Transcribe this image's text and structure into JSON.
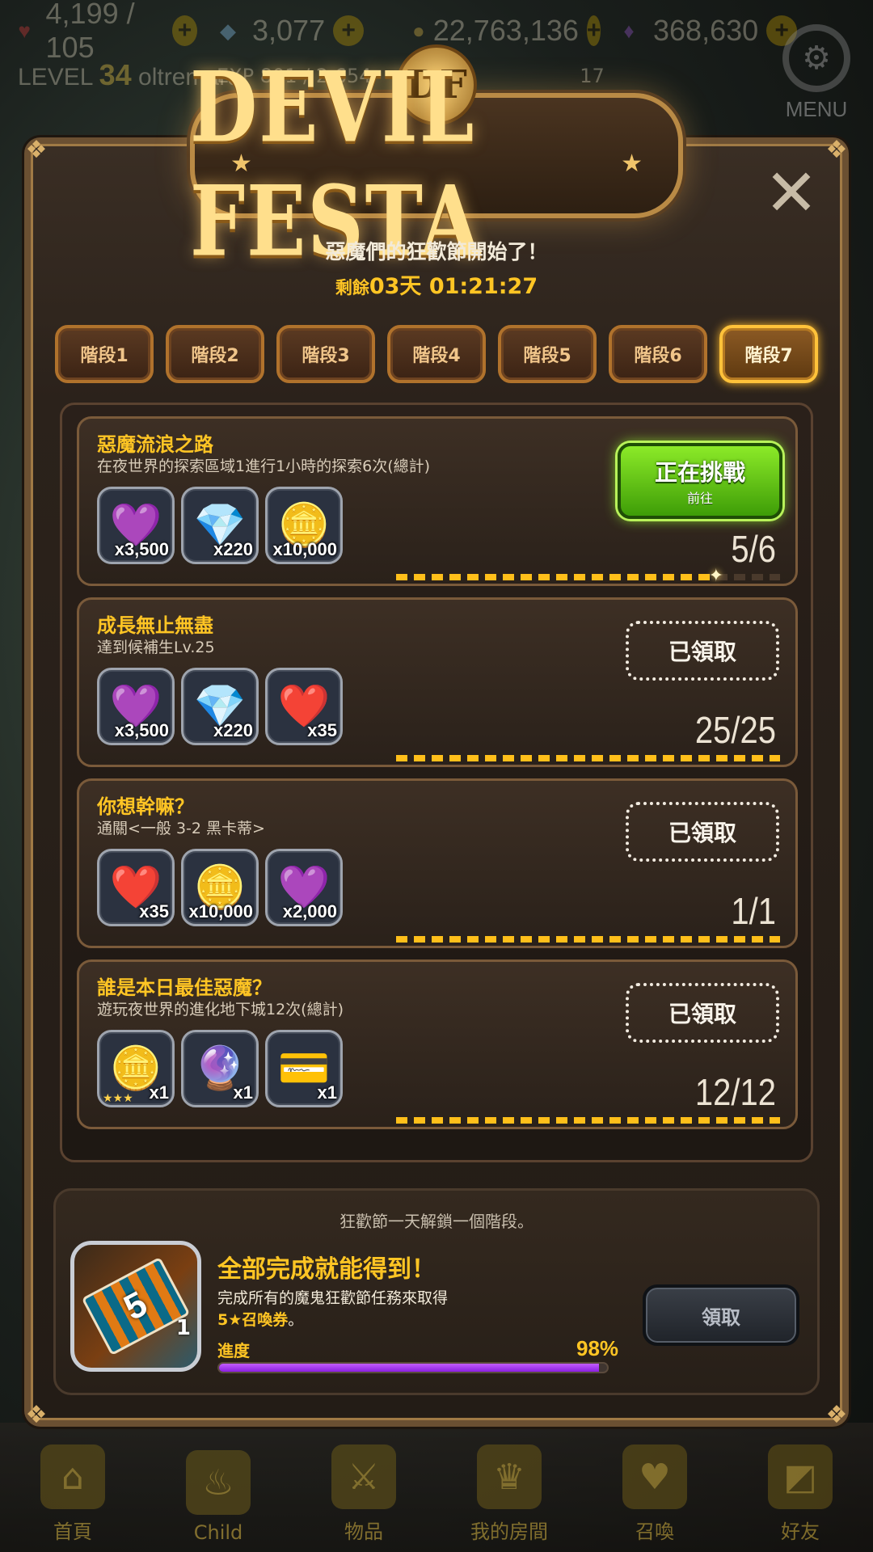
{
  "hud": {
    "stamina": "4,199 / 105",
    "crystals": "3,077",
    "gold": "22,763,136",
    "gems": "368,630",
    "level_label": "LEVEL",
    "level_value": "34",
    "player_name": "oltremare",
    "exp": "EXP 801 / 2,654",
    "tickets": "17",
    "menu_label": "MENU"
  },
  "dialog": {
    "title": "DEVIL FESTA",
    "crest": "DF",
    "subtitle": "惡魔們的狂歡節開始了！",
    "countdown_label": "剩餘",
    "countdown_value": "03天 01:21:27",
    "close": "✕"
  },
  "stage_tabs": [
    {
      "label": "階段1",
      "active": false
    },
    {
      "label": "階段2",
      "active": false
    },
    {
      "label": "階段3",
      "active": false
    },
    {
      "label": "階段4",
      "active": false
    },
    {
      "label": "階段5",
      "active": false
    },
    {
      "label": "階段6",
      "active": false
    },
    {
      "label": "階段7",
      "active": true
    }
  ],
  "missions": [
    {
      "title": "惡魔流浪之路",
      "desc": "在夜世界的探索區域1進行1小時的探索6次(總計)",
      "rewards": [
        {
          "icon": "purple-gem-icon",
          "glyph": "💜",
          "qty": "x3,500"
        },
        {
          "icon": "rainbow-crystal-icon",
          "glyph": "💎",
          "qty": "x220"
        },
        {
          "icon": "gold-coins-icon",
          "glyph": "🪙",
          "qty": "x10,000"
        }
      ],
      "progress_text": "5/6",
      "progress": 0.8333,
      "status": "challenge",
      "button_main": "正在挑戰",
      "button_sub": "前往"
    },
    {
      "title": "成長無止無盡",
      "desc": "達到候補生Lv.25",
      "rewards": [
        {
          "icon": "purple-gem-icon",
          "glyph": "💜",
          "qty": "x3,500"
        },
        {
          "icon": "rainbow-crystal-icon",
          "glyph": "💎",
          "qty": "x220"
        },
        {
          "icon": "heart-icon",
          "glyph": "❤️",
          "qty": "x35"
        }
      ],
      "progress_text": "25/25",
      "progress": 1.0,
      "status": "claimed",
      "button_main": "已領取"
    },
    {
      "title": "你想幹嘛？",
      "desc": "通關<一般 3-2 黑卡蒂>",
      "rewards": [
        {
          "icon": "heart-icon",
          "glyph": "❤️",
          "qty": "x35"
        },
        {
          "icon": "gold-coins-icon",
          "glyph": "🪙",
          "qty": "x10,000"
        },
        {
          "icon": "purple-gem-icon",
          "glyph": "💜",
          "qty": "x2,000"
        }
      ],
      "progress_text": "1/1",
      "progress": 1.0,
      "status": "claimed",
      "button_main": "已領取"
    },
    {
      "title": "誰是本日最佳惡魔？",
      "desc": "遊玩夜世界的進化地下城12次(總計)",
      "rewards": [
        {
          "icon": "gold-coins-icon",
          "glyph": "🪙",
          "qty": "x1",
          "stars": "★★★"
        },
        {
          "icon": "rainbow-orb-icon",
          "glyph": "🔮",
          "qty": "x1"
        },
        {
          "icon": "platinum-card-icon",
          "glyph": "💳",
          "qty": "x1"
        }
      ],
      "progress_text": "12/12",
      "progress": 1.0,
      "status": "claimed",
      "button_main": "已領取"
    }
  ],
  "footer": {
    "unlock_note": "狂歡節一天解鎖一個階段。",
    "ticket_face": "5",
    "ticket_qty": "1",
    "title": "全部完成就能得到！",
    "desc_line1": "完成所有的魔鬼狂歡節任務來取得",
    "desc_hl": "5★召喚券",
    "desc_tail": "。",
    "progress_label": "進度",
    "progress_pct": "98%",
    "progress": 0.98,
    "claim_label": "領取"
  },
  "bottom_nav": [
    {
      "label": "首頁",
      "icon": "home-icon",
      "glyph": "⌂"
    },
    {
      "label": "Child",
      "icon": "flame-icon",
      "glyph": "♨"
    },
    {
      "label": "物品",
      "icon": "sword-shield-icon",
      "glyph": "⚔"
    },
    {
      "label": "我的房間",
      "icon": "crown-icon",
      "glyph": "♛"
    },
    {
      "label": "召喚",
      "icon": "summon-bottle-icon",
      "glyph": "♥"
    },
    {
      "label": "好友",
      "icon": "friend-shield-icon",
      "glyph": "◩"
    }
  ],
  "colors": {
    "accent_gold": "#ffc524",
    "challenge_green": "#6fd21a",
    "progress_purple": "#a93cf0"
  }
}
